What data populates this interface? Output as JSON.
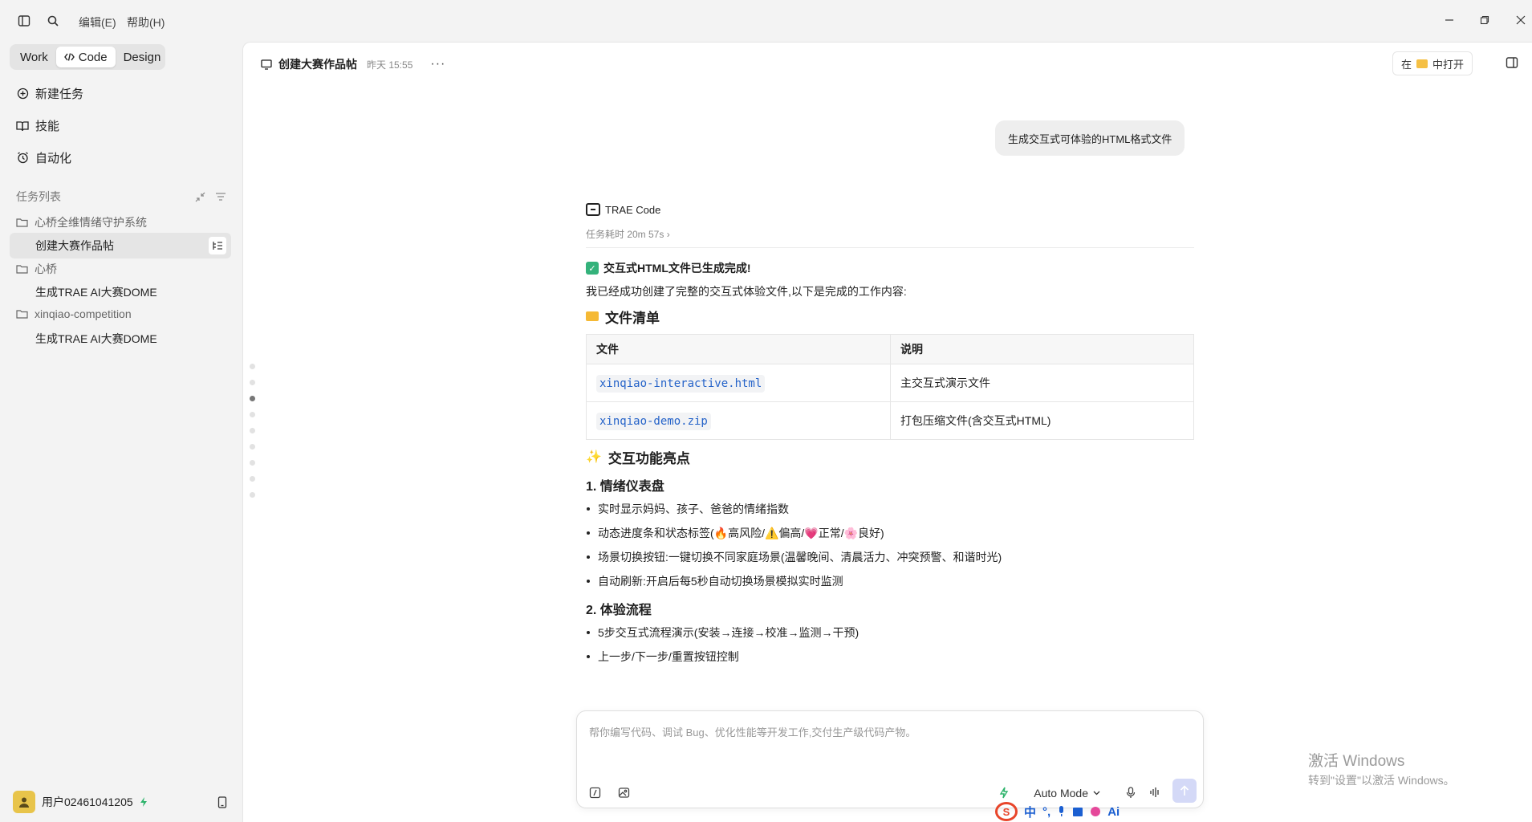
{
  "titlebar": {
    "menu_edit": "编辑(E)",
    "menu_help": "帮助(H)"
  },
  "sidebar": {
    "modes": [
      "Work",
      "Code",
      "Design"
    ],
    "active_mode": "Code",
    "nav": {
      "new_task": "新建任务",
      "skills": "技能",
      "automation": "自动化"
    },
    "task_list_title": "任务列表",
    "groups": [
      {
        "name": "心桥全维情绪守护系统",
        "items": [
          "创建大赛作品帖"
        ]
      },
      {
        "name": "心桥",
        "items": [
          "生成TRAE AI大赛DOME"
        ]
      },
      {
        "name": "xinqiao-competition",
        "items": [
          "生成TRAE AI大赛DOME"
        ]
      }
    ],
    "user_name": "用户02461041205"
  },
  "main": {
    "title": "创建大赛作品帖",
    "time": "昨天 15:55",
    "open_in_prefix": "在",
    "open_in_suffix": "中打开",
    "user_message": "生成交互式可体验的HTML格式文件",
    "agent_name": "TRAE Code",
    "duration": "任务耗时 20m 57s",
    "done_heading": "交互式HTML文件已生成完成!",
    "intro": "我已经成功创建了完整的交互式体验文件,以下是完成的工作内容:",
    "files_heading": "文件清单",
    "table": {
      "headers": [
        "文件",
        "说明"
      ],
      "rows": [
        {
          "file": "xinqiao-interactive.html",
          "desc": "主交互式演示文件"
        },
        {
          "file": "xinqiao-demo.zip",
          "desc": "打包压缩文件(含交互式HTML)"
        }
      ]
    },
    "highlights_heading": "交互功能亮点",
    "section1_title": "1. 情绪仪表盘",
    "section1_bullets": [
      "实时显示妈妈、孩子、爸爸的情绪指数",
      "动态进度条和状态标签(🔥高风险/⚠️偏高/💗正常/🌸良好)",
      "场景切换按钮:一键切换不同家庭场景(温馨晚间、清晨活力、冲突预警、和谐时光)",
      "自动刷新:开启后每5秒自动切换场景模拟实时监测"
    ],
    "section2_title": "2. 体验流程",
    "section2_bullets": [
      "5步交互式流程演示(安装→连接→校准→监测→干预)",
      "上一步/下一步/重置按钮控制"
    ]
  },
  "composer": {
    "placeholder": "帮你编写代码、调试 Bug、优化性能等开发工作,交付生产级代码产物。",
    "mode": "Auto Mode"
  },
  "watermark": {
    "line1": "激活 Windows",
    "line2": "转到\"设置\"以激活 Windows。"
  },
  "ime": {
    "label": "中",
    "ai": "Ai"
  }
}
